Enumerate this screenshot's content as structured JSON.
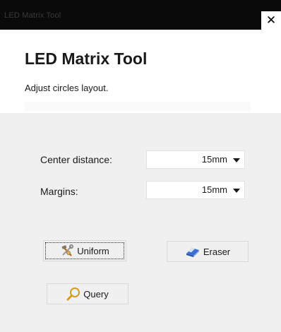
{
  "window": {
    "title": "LED Matrix Tool",
    "close_glyph": "✕"
  },
  "header": {
    "heading": "LED Matrix Tool",
    "subtitle": "Adjust circles layout."
  },
  "form": {
    "center_distance_label": "Center distance:",
    "center_distance_value": "15mm",
    "margins_label": "Margins:",
    "margins_value": "15mm"
  },
  "buttons": {
    "uniform": {
      "label": "Uniform",
      "icon": "tools-icon"
    },
    "eraser": {
      "label": "Eraser",
      "icon": "eraser-icon"
    },
    "query": {
      "label": "Query",
      "icon": "magnifier-icon"
    }
  }
}
